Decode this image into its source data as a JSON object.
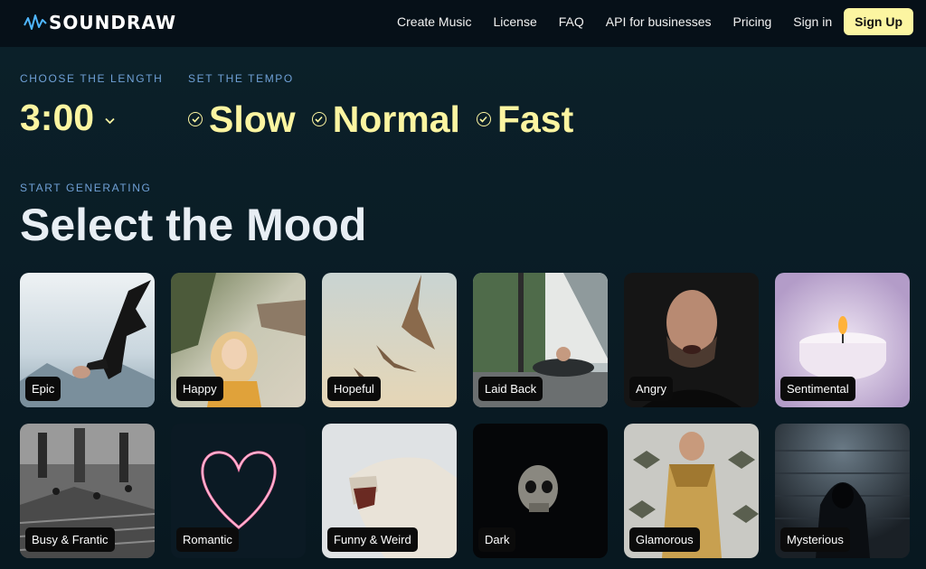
{
  "brand": {
    "name": "SOUNDRAW"
  },
  "nav": {
    "links": [
      "Create Music",
      "License",
      "FAQ",
      "API for businesses",
      "Pricing",
      "Sign in"
    ],
    "signup": "Sign Up"
  },
  "length": {
    "label": "CHOOSE THE LENGTH",
    "value": "3:00"
  },
  "tempo": {
    "label": "SET THE TEMPO",
    "options": [
      "Slow",
      "Normal",
      "Fast"
    ]
  },
  "mood": {
    "kicker": "START GENERATING",
    "title": "Select the Mood",
    "cards": [
      "Epic",
      "Happy",
      "Hopeful",
      "Laid Back",
      "Angry",
      "Sentimental",
      "Busy & Frantic",
      "Romantic",
      "Funny & Weird",
      "Dark",
      "Glamorous",
      "Mysterious"
    ]
  },
  "colors": {
    "accent": "#fcf5a1",
    "label_blue": "#6fa0d6",
    "bg": "#0a1a22"
  }
}
